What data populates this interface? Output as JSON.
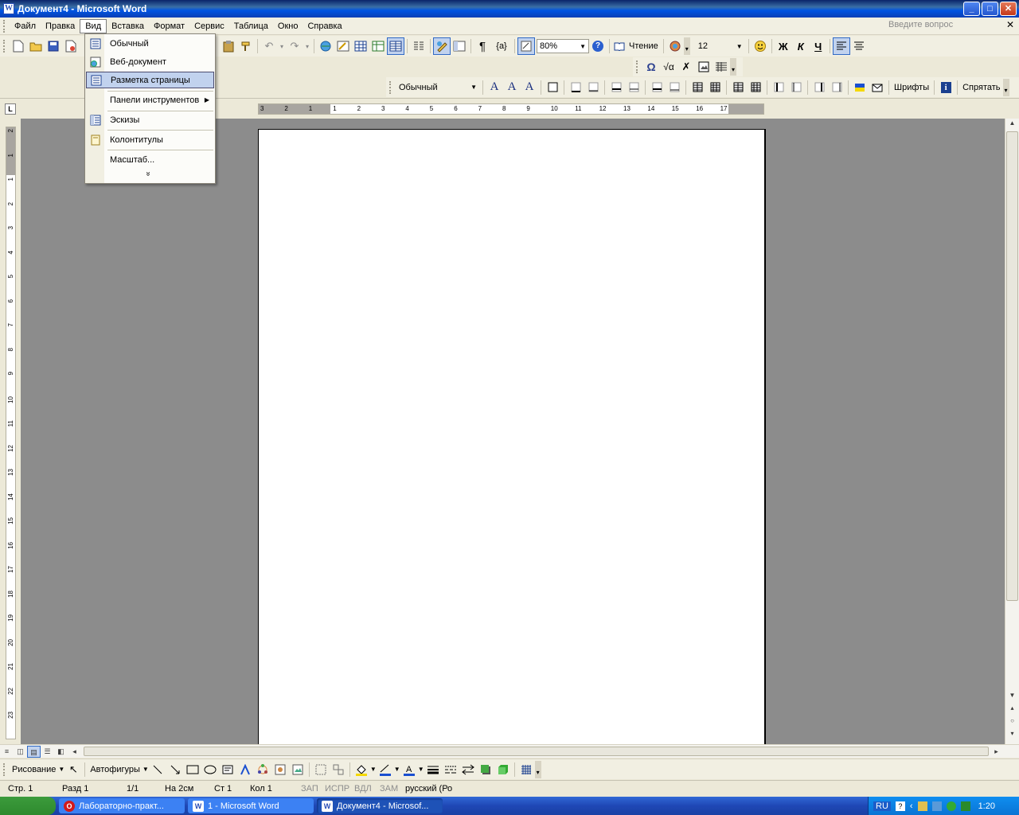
{
  "window": {
    "title": "Документ4 - Microsoft Word",
    "app_icon": "W",
    "controls": {
      "minimize": "_",
      "maximize": "□",
      "close": "✕"
    }
  },
  "menubar": {
    "items": [
      {
        "label": "Файл",
        "active": false
      },
      {
        "label": "Правка",
        "active": false
      },
      {
        "label": "Вид",
        "active": true
      },
      {
        "label": "Вставка",
        "active": false
      },
      {
        "label": "Формат",
        "active": false
      },
      {
        "label": "Сервис",
        "active": false
      },
      {
        "label": "Таблица",
        "active": false
      },
      {
        "label": "Окно",
        "active": false
      },
      {
        "label": "Справка",
        "active": false
      }
    ],
    "ask_placeholder": "Введите вопрос",
    "close_doc": "✕"
  },
  "standard_toolbar": {
    "zoom": "80%",
    "read_label": "Чтение",
    "font_size": "12",
    "bold": "Ж",
    "italic": "К",
    "underline": "Ч",
    "pilcrow": "¶",
    "field": "{a}",
    "help": "?"
  },
  "formula_toolbar": {
    "omega": "Ω",
    "sqrt": "√α",
    "cross": "✗"
  },
  "style_toolbar": {
    "style": "Обычный",
    "fonts_label": "Шрифты",
    "hide_label": "Спрятать",
    "info": "i"
  },
  "view_menu": {
    "items": [
      {
        "label": "Обычный",
        "icon": "normal-view-icon",
        "highlighted": false
      },
      {
        "label": "Веб-документ",
        "icon": "web-view-icon",
        "highlighted": false
      },
      {
        "label": "Разметка страницы",
        "icon": "page-layout-icon",
        "highlighted": true
      },
      {
        "label": "Панели инструментов",
        "icon": "",
        "highlighted": false,
        "submenu": true
      },
      {
        "label": "Эскизы",
        "icon": "thumbnails-icon",
        "highlighted": false
      },
      {
        "label": "Колонтитулы",
        "icon": "header-footer-icon",
        "highlighted": false
      },
      {
        "label": "Масштаб...",
        "icon": "",
        "highlighted": false
      }
    ],
    "more": "»"
  },
  "ruler": {
    "tab_selector": "L",
    "h_ticks": [
      "3",
      "2",
      "1",
      "1",
      "2",
      "3",
      "4",
      "5",
      "6",
      "7",
      "8",
      "9",
      "10",
      "11",
      "12",
      "13",
      "14",
      "15",
      "16",
      "17"
    ],
    "v_ticks": [
      "2",
      "1",
      "1",
      "2",
      "3",
      "4",
      "5",
      "6",
      "7",
      "8",
      "9",
      "10",
      "11",
      "12",
      "13",
      "14",
      "15",
      "16",
      "17",
      "18",
      "19",
      "20",
      "21",
      "22",
      "23"
    ]
  },
  "drawing_toolbar": {
    "drawing_label": "Рисование",
    "autoshapes_label": "Автофигуры"
  },
  "statusbar": {
    "page": "Стр. 1",
    "section": "Разд 1",
    "pages": "1/1",
    "at": "На 2см",
    "line": "Ст 1",
    "col": "Кол 1",
    "rec": "ЗАП",
    "trk": "ИСПР",
    "ext": "ВДЛ",
    "ovr": "ЗАМ",
    "lang": "русский (Ро"
  },
  "taskbar": {
    "tasks": [
      {
        "label": "Лабораторно-практ...",
        "icon": "O",
        "active": false
      },
      {
        "label": "1 - Microsoft Word",
        "icon": "W",
        "active": false
      },
      {
        "label": "Документ4 - Microsof...",
        "icon": "W",
        "active": true
      }
    ],
    "lang": "RU",
    "clock": "1:20"
  },
  "colors": {
    "accent": "#316ac5",
    "highlight": "#c1d2ee",
    "doc_background": "#8c8c8c"
  }
}
